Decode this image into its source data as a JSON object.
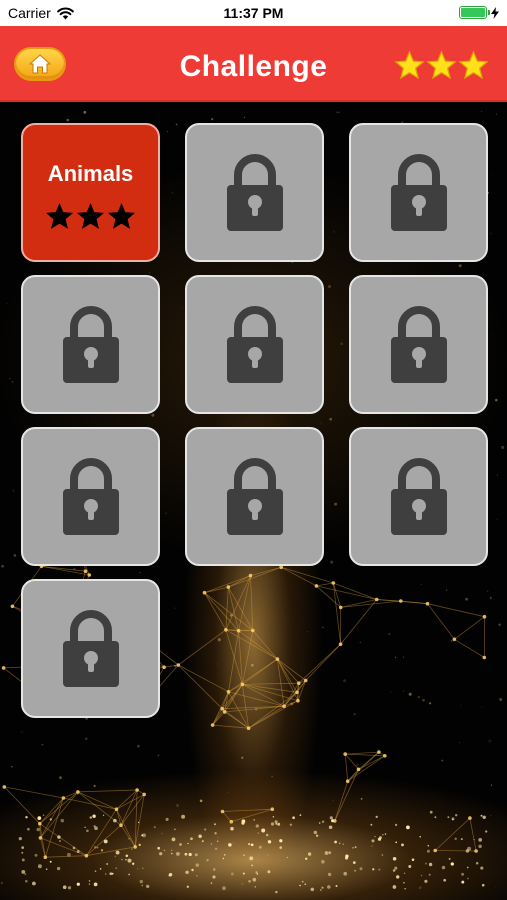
{
  "status_bar": {
    "carrier": "Carrier",
    "time": "11:37 PM"
  },
  "header": {
    "title": "Challenge",
    "home_icon": "home-icon",
    "stars_earned": 3,
    "star_color": "#ffe01b"
  },
  "levels": [
    {
      "name": "Animals",
      "locked": false,
      "stars": 3
    },
    {
      "name": "",
      "locked": true
    },
    {
      "name": "",
      "locked": true
    },
    {
      "name": "",
      "locked": true
    },
    {
      "name": "",
      "locked": true
    },
    {
      "name": "",
      "locked": true
    },
    {
      "name": "",
      "locked": true
    },
    {
      "name": "",
      "locked": true
    },
    {
      "name": "",
      "locked": true
    },
    {
      "name": "",
      "locked": true
    }
  ],
  "colors": {
    "header_red": "#ee3b36",
    "unlocked_tile": "#d32d11",
    "locked_tile": "#a7a7a7",
    "lock_icon": "#3f3f3f"
  }
}
